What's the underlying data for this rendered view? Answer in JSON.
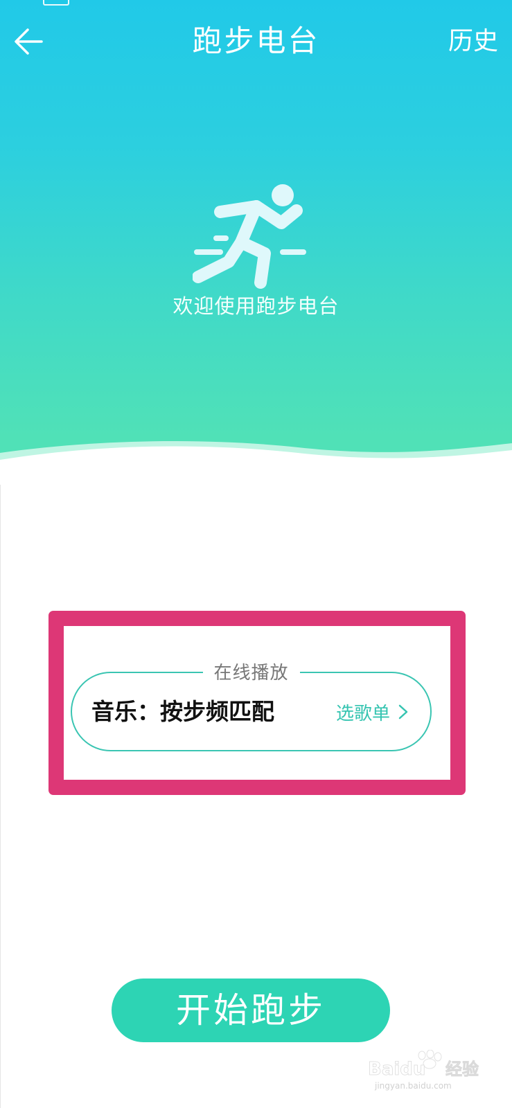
{
  "header": {
    "title": "跑步电台",
    "history_label": "历史",
    "back_icon": "arrow-left-icon"
  },
  "hero": {
    "welcome_text": "欢迎使用跑步电台",
    "runner_icon": "running-person-icon"
  },
  "play_card": {
    "legend": "在线播放",
    "music_label": "音乐：按步频匹配",
    "playlist_label": "选歌单",
    "chevron_icon": "chevron-right-icon"
  },
  "start_button": {
    "label": "开始跑步"
  },
  "watermark": {
    "brand_latin": "Baidu",
    "brand_cn": "经验",
    "domain": "jingyan.baidu.com"
  },
  "colors": {
    "hero_top": "#21c9e8",
    "hero_bottom": "#50e1b7",
    "accent": "#2dd4b4",
    "highlight_border": "#dd3776"
  }
}
